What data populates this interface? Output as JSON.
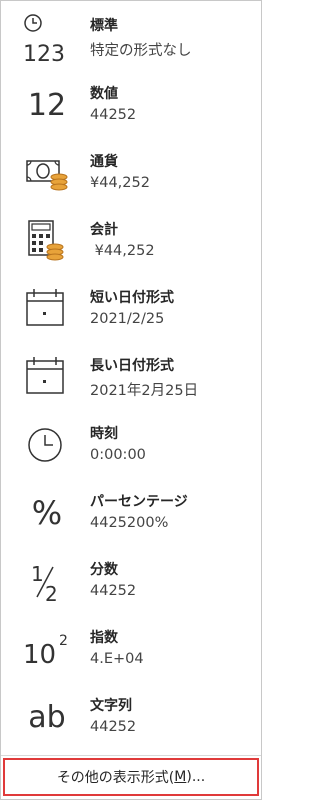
{
  "items": [
    {
      "name": "標準",
      "example": "特定の形式なし",
      "icon": "clock-123-icon",
      "icon_text": "123"
    },
    {
      "name": "数値",
      "example": "44252",
      "icon": "number-12-icon",
      "icon_text": "12"
    },
    {
      "name": "通貨",
      "example": "¥44,252",
      "icon": "currency-icon"
    },
    {
      "name": "会計",
      "example": " ¥44,252",
      "icon": "accounting-calculator-icon"
    },
    {
      "name": "短い日付形式",
      "example": "2021/2/25",
      "icon": "calendar-short-icon"
    },
    {
      "name": "長い日付形式",
      "example": "2021年2月25日",
      "icon": "calendar-long-icon"
    },
    {
      "name": "時刻",
      "example": "0:00:00",
      "icon": "clock-icon"
    },
    {
      "name": "パーセンテージ",
      "example": "4425200%",
      "icon": "percent-icon",
      "icon_text": "%"
    },
    {
      "name": "分数",
      "example": "44252",
      "icon": "fraction-icon"
    },
    {
      "name": "指数",
      "example": "4.E+04",
      "icon": "exponent-icon"
    },
    {
      "name": "文字列",
      "example": "44252",
      "icon": "text-ab-icon",
      "icon_text": "ab"
    }
  ],
  "more": {
    "label_before": "その他の表示形式(",
    "accelerator": "M",
    "label_after": ")..."
  },
  "colors": {
    "icon_stroke": "#333333",
    "coin": "#e8a33a",
    "coin_dark": "#b8741e",
    "focus_border": "#e03a3a"
  }
}
